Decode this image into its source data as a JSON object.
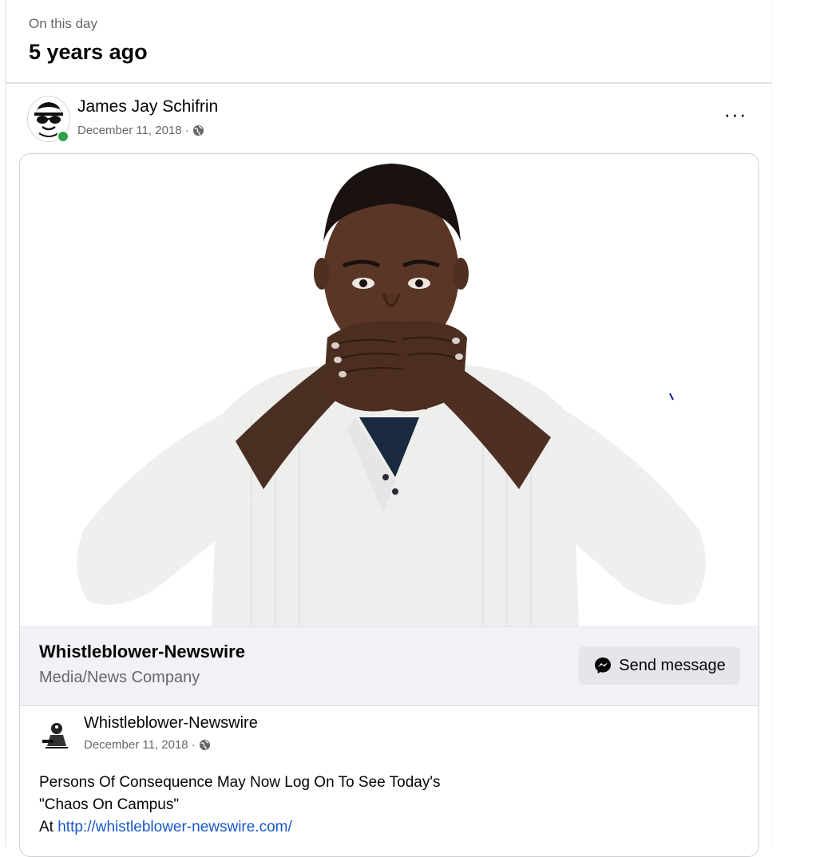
{
  "memory": {
    "eyebrow": "On this day",
    "title": "5 years ago"
  },
  "post": {
    "author": "James Jay Schifrin",
    "date": "December 11, 2018",
    "meta_separator": "·",
    "more_label": "···"
  },
  "link_preview": {
    "page_name": "Whistleblower-Newswire",
    "category": "Media/News Company",
    "send_message_label": "Send message"
  },
  "shared_post": {
    "author": "Whistleblower-Newswire",
    "date": "December 11, 2018",
    "meta_separator": "·",
    "line1": "Persons Of Consequence May Now Log On To See Today's",
    "line2": "\"Chaos On Campus\"",
    "line3_prefix": "At ",
    "url": "http://whistleblower-newswire.com/"
  }
}
